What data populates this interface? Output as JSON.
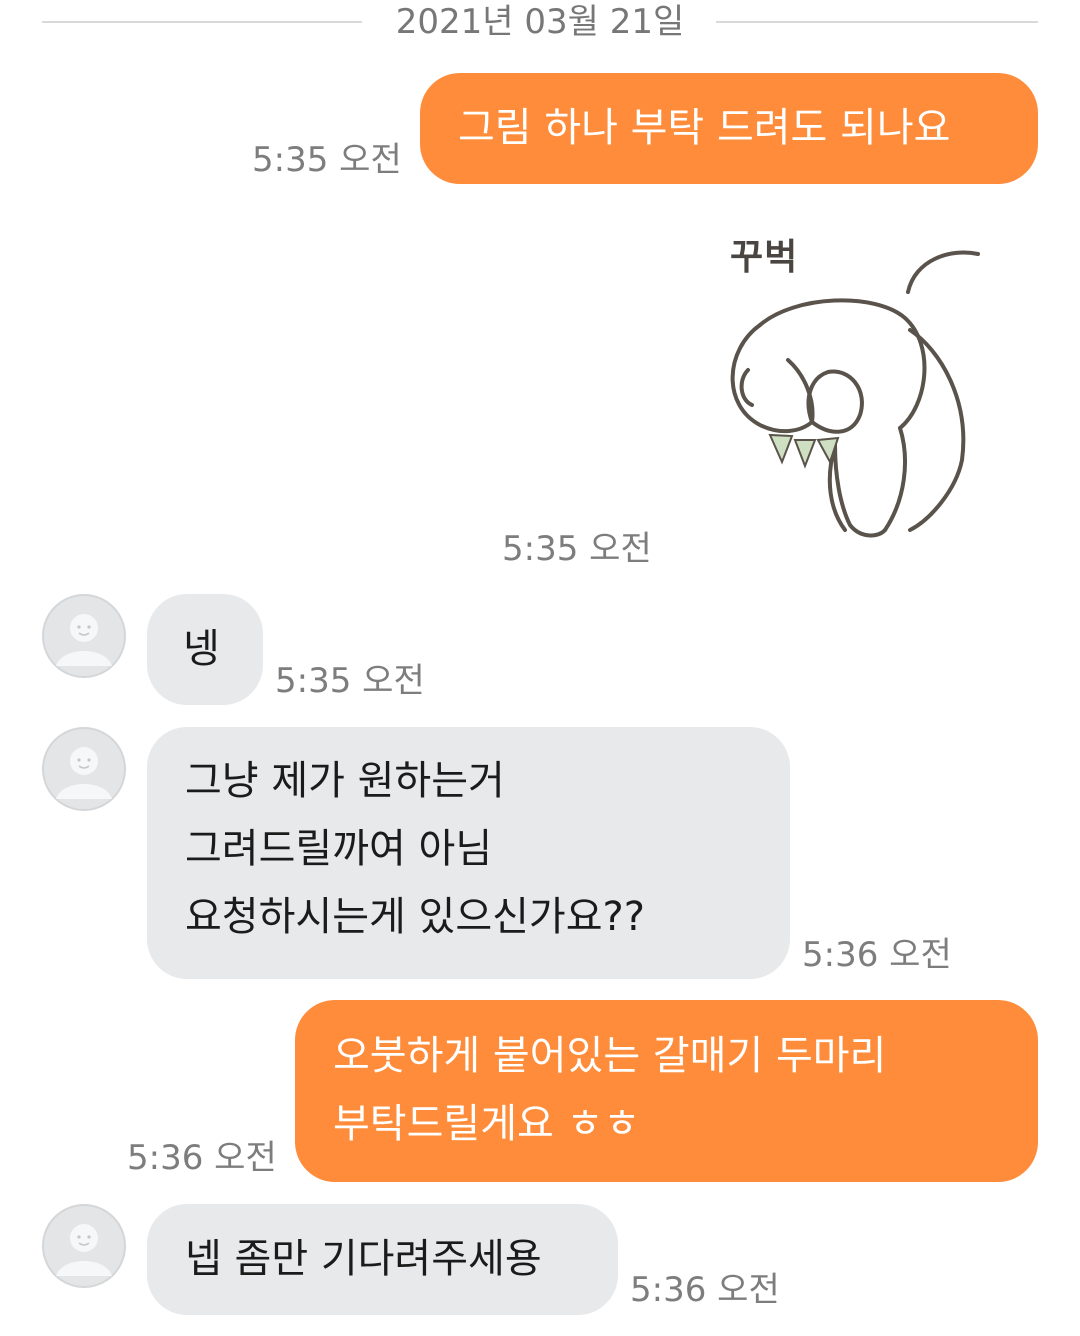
{
  "date_divider": "2021년 03월 21일",
  "messages": [
    {
      "side": "out",
      "lines": [
        "그림 하나 부탁 드려도 되나요"
      ],
      "time": "5:35 오전"
    },
    {
      "side": "out",
      "type": "sticker",
      "sticker_text": "꾸벅",
      "sticker_icon": "bowing-bunny-icon",
      "time": "5:35 오전"
    },
    {
      "side": "in",
      "lines": [
        "넹"
      ],
      "time": "5:35 오전"
    },
    {
      "side": "in",
      "lines": [
        "그냥 제가 원하는거",
        "그려드릴까여 아님",
        "요청하시는게 있으신가요??"
      ],
      "time": "5:36 오전"
    },
    {
      "side": "out",
      "lines": [
        "오붓하게 붙어있는 갈매기 두마리",
        "부탁드릴게요 ㅎㅎ"
      ],
      "time": "5:36 오전"
    },
    {
      "side": "in",
      "lines": [
        "넵 좀만 기다려주세용"
      ],
      "time": "5:36 오전"
    }
  ],
  "colors": {
    "outgoing_bubble": "#ff8c3a",
    "incoming_bubble": "#e7e9eb",
    "timestamp": "#7d7d7d",
    "divider": "#d9d9d9"
  }
}
